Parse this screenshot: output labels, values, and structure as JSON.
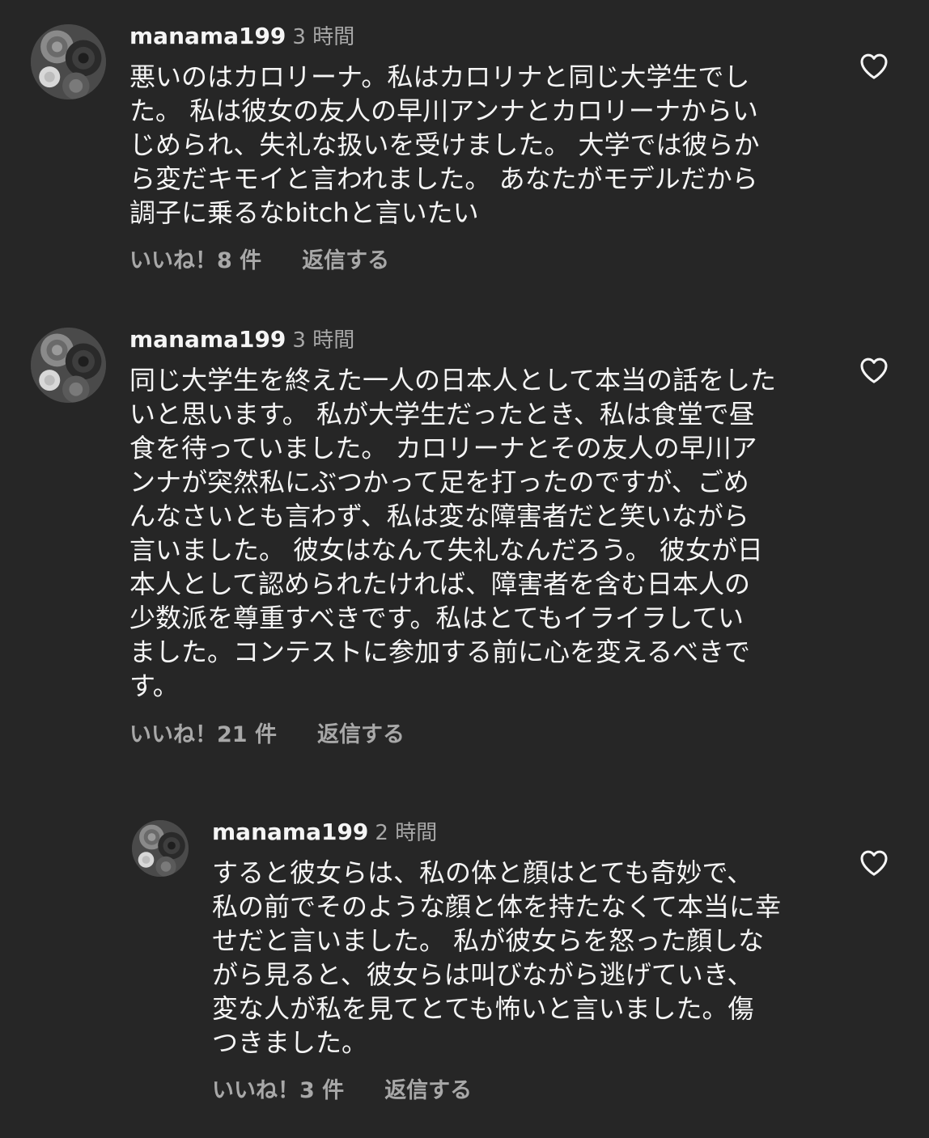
{
  "comments": [
    {
      "username": "manama199",
      "time": "3 時間",
      "lines": [
        "悪いのはカロリーナ。私はカロリナと同じ大学生でし",
        "た。 私は彼女の友人の早川アンナとカロリーナからい",
        "じめられ、失礼な扱いを受けました。 大学では彼らか",
        "ら変だキモイと言われました。 あなたがモデルだから",
        "調子に乗るなbitchと言いたい"
      ],
      "likes": "いいね！8 件",
      "reply": "返信する"
    },
    {
      "username": "manama199",
      "time": "3 時間",
      "lines": [
        "同じ大学生を終えた一人の日本人として本当の話をした",
        "いと思います。 私が大学生だったとき、私は食堂で昼",
        "食を待っていました。 カロリーナとその友人の早川ア",
        "ンナが突然私にぶつかって足を打ったのですが、ごめ",
        "んなさいとも言わず、私は変な障害者だと笑いながら",
        "言いました。 彼女はなんて失礼なんだろう。 彼女が日",
        "本人として認められたければ、障害者を含む日本人の",
        "少数派を尊重すべきです。私はとてもイライラしてい",
        "ました。コンテストに参加する前に心を変えるべきで",
        "す。"
      ],
      "likes": "いいね！21 件",
      "reply": "返信する"
    },
    {
      "username": "manama199",
      "time": "2 時間",
      "lines": [
        "すると彼女らは、私の体と顔はとても奇妙で、",
        "私の前でそのような顔と体を持たなくて本当に幸",
        "せだと言いました。 私が彼女らを怒った顔しな",
        "がら見ると、彼女らは叫びながら逃げていき、",
        "変な人が私を見てとても怖いと言いました。傷",
        "つきました。"
      ],
      "likes": "いいね！3 件",
      "reply": "返信する"
    }
  ],
  "icons": {
    "avatar": "rose-avatar-icon",
    "like": "heart-outline-icon"
  },
  "colors": {
    "background": "#262626",
    "primary_text": "#f5f5f5",
    "secondary_text": "#a8a8a8"
  }
}
